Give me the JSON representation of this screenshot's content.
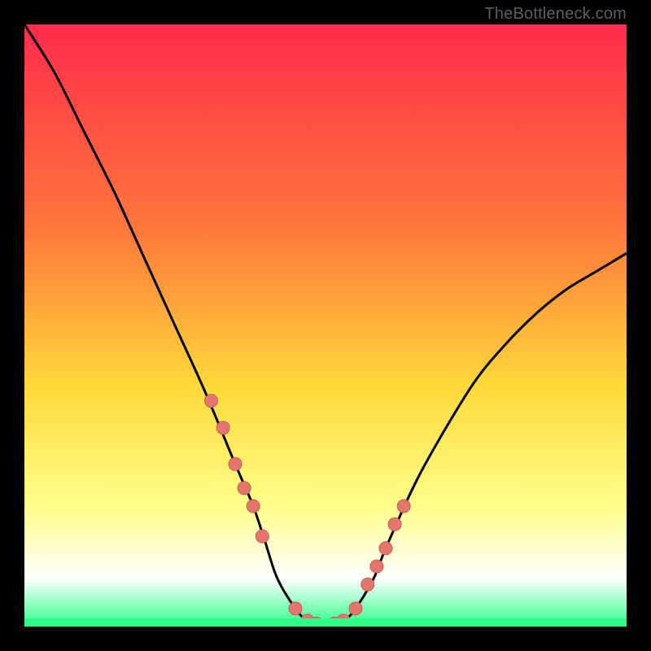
{
  "attribution": "TheBottleneck.com",
  "colors": {
    "bg_black": "#000000",
    "grad_top": "#ff2b4b",
    "grad_mid1": "#ff7a3a",
    "grad_mid2": "#ffd83a",
    "grad_mid3": "#ffff8a",
    "grad_mid4": "#ffffff",
    "grad_bottom": "#2cff88",
    "curve": "#000000",
    "marker_fill": "#e5766e",
    "marker_stroke": "#c95a56"
  },
  "chart_data": {
    "type": "line",
    "title": "",
    "xlabel": "",
    "ylabel": "",
    "xlim": [
      0,
      100
    ],
    "ylim": [
      0,
      100
    ],
    "grid": false,
    "series": [
      {
        "name": "bottleneck-curve",
        "x": [
          0,
          5,
          10,
          15,
          20,
          25,
          30,
          35,
          38,
          40,
          42,
          45,
          47,
          50,
          53,
          55,
          58,
          60,
          65,
          70,
          75,
          80,
          85,
          90,
          95,
          100
        ],
        "values": [
          100,
          92,
          82,
          72,
          61,
          50,
          39,
          27,
          20,
          14,
          8,
          3,
          1,
          0,
          1,
          3,
          8,
          13,
          24,
          33,
          41,
          47,
          52,
          56,
          59,
          62
        ]
      }
    ],
    "markers": {
      "name": "highlight-points",
      "x": [
        31,
        33,
        35,
        36.5,
        38,
        39.5,
        45,
        47,
        48.5,
        50,
        51.5,
        53,
        55,
        57,
        58.5,
        60,
        61.5,
        63
      ],
      "values": [
        37.5,
        33,
        27,
        23,
        20,
        15,
        3,
        1,
        0.5,
        0,
        0.5,
        1,
        3,
        7,
        10,
        13,
        17,
        20
      ]
    }
  }
}
